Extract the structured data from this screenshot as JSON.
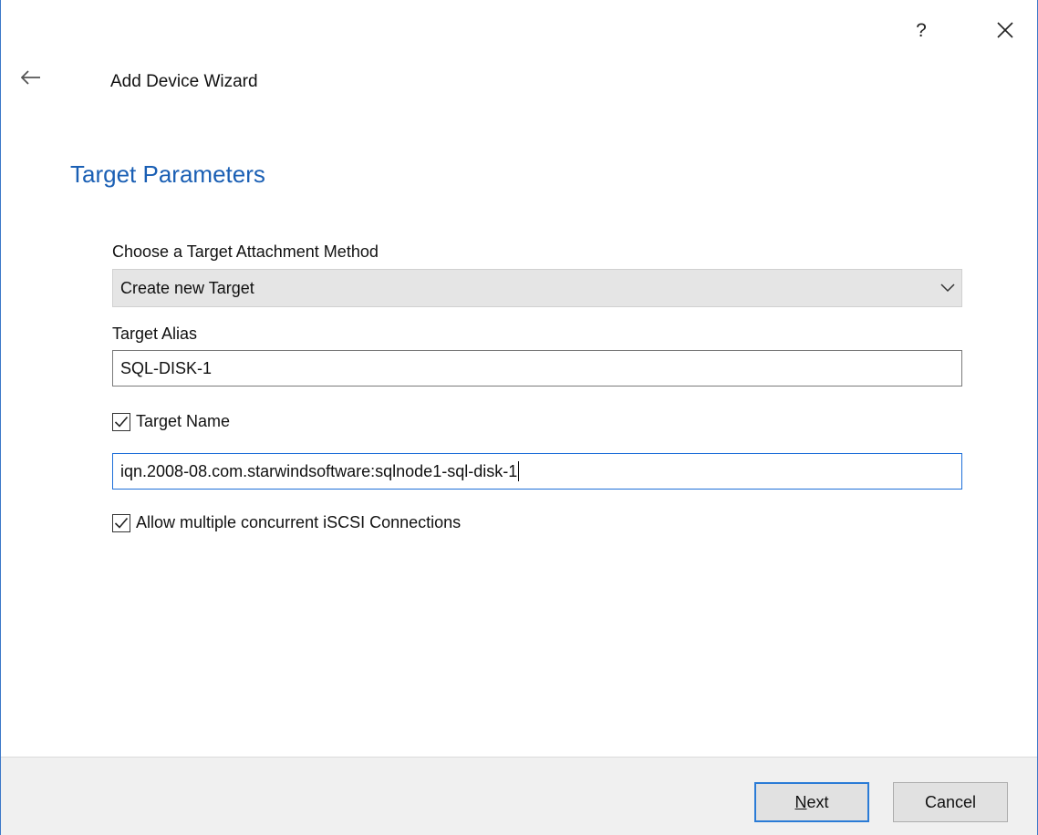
{
  "titlebar": {
    "help_label": "?",
    "close_icon": "close-icon"
  },
  "header": {
    "back_icon": "arrow-left-icon",
    "wizard_title": "Add Device Wizard"
  },
  "page": {
    "heading": "Target Parameters",
    "heading_color": "#1a5fb4"
  },
  "form": {
    "attachment_method": {
      "label": "Choose a Target Attachment Method",
      "selected": "Create new Target"
    },
    "target_alias": {
      "label": "Target Alias",
      "value": "SQL-DISK-1"
    },
    "target_name": {
      "checkbox_label": "Target Name",
      "checked": true,
      "value": "iqn.2008-08.com.starwindsoftware:sqlnode1-sql-disk-1"
    },
    "concurrent_connections": {
      "checkbox_label": "Allow multiple concurrent iSCSI Connections",
      "checked": true
    }
  },
  "footer": {
    "next_label": "Next",
    "cancel_label": "Cancel"
  }
}
